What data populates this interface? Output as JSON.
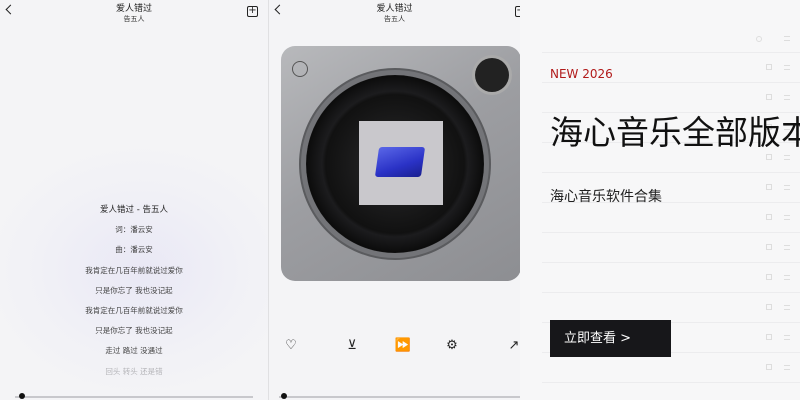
{
  "lyrics_panel": {
    "title": "爱人错过",
    "artist": "告五人",
    "lines": [
      "爱人错过 - 告五人",
      "词：潘云安",
      "曲：潘云安",
      "我肯定在几百年前就说过爱你",
      "只是你忘了 我也没记起",
      "我肯定在几百年前就说过爱你",
      "只是你忘了 我也没记起",
      "走过 路过 没遇过",
      "回头 转头 还是错"
    ]
  },
  "player_panel": {
    "title": "爱人错过",
    "controls": [
      "heart-icon",
      "download-icon",
      "skip-icon",
      "settings-icon",
      "share-icon"
    ]
  },
  "banner": {
    "tag": "NEW 2026",
    "headline": "海心音乐全部版本",
    "subtitle": "海心音乐软件合集",
    "cta": "立即查看 >",
    "colors": {
      "tag": "#b11a1a",
      "cta_bg": "#17171a"
    }
  }
}
